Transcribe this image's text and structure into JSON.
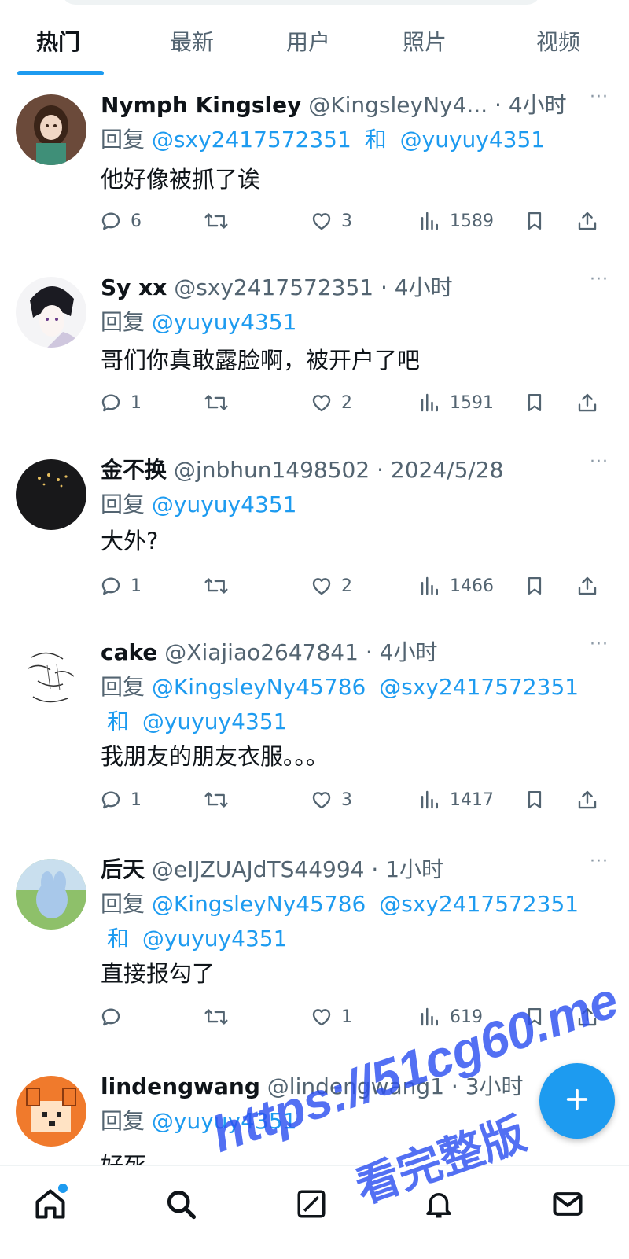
{
  "tabs": [
    {
      "label": "热门",
      "active": true
    },
    {
      "label": "最新",
      "active": false
    },
    {
      "label": "用户",
      "active": false
    },
    {
      "label": "照片",
      "active": false
    },
    {
      "label": "视频",
      "active": false
    }
  ],
  "posts": [
    {
      "name": "Nymph Kingsley",
      "handle": "@KingsleyNy4...",
      "time": "4小时",
      "reply_prefix": "回复",
      "mentions": [
        "@sxy2417572351",
        "和",
        "@yuyuy4351"
      ],
      "text": "他好像被抓了诶",
      "replies": "6",
      "reposts": "",
      "likes": "3",
      "views": "1589"
    },
    {
      "name": "Sy xx",
      "handle": "@sxy2417572351",
      "time": "4小时",
      "reply_prefix": "回复",
      "mentions": [
        "@yuyuy4351"
      ],
      "text": "哥们你真敢露脸啊，被开户了吧",
      "replies": "1",
      "reposts": "",
      "likes": "2",
      "views": "1591"
    },
    {
      "name": "金不换",
      "handle": "@jnbhun1498502",
      "time": "2024/5/28",
      "reply_prefix": "回复",
      "mentions": [
        "@yuyuy4351"
      ],
      "text": "大外?",
      "replies": "1",
      "reposts": "",
      "likes": "2",
      "views": "1466"
    },
    {
      "name": "cake",
      "handle": "@Xiajiao2647841",
      "time": "4小时",
      "reply_prefix": "回复",
      "mentions": [
        "@KingsleyNy45786",
        "@sxy2417572351",
        "和",
        "@yuyuy4351"
      ],
      "text": "我朋友的朋友衣服。。。",
      "replies": "1",
      "reposts": "",
      "likes": "3",
      "views": "1417"
    },
    {
      "name": "后天",
      "handle": "@eIJZUAJdTS44994",
      "time": "1小时",
      "reply_prefix": "回复",
      "mentions": [
        "@KingsleyNy45786",
        "@sxy2417572351",
        "和",
        "@yuyuy4351"
      ],
      "text": "直接报勾了",
      "replies": "",
      "reposts": "",
      "likes": "1",
      "views": "619"
    },
    {
      "name": "lindengwang",
      "handle": "@lindengwang1",
      "time": "3小时",
      "reply_prefix": "回复",
      "mentions": [
        "@yuyuy4351"
      ],
      "text": "好死",
      "replies": "",
      "reposts": "",
      "likes": "",
      "views": ""
    }
  ],
  "separator_dot": "·",
  "more_glyph": "···",
  "fab_icon": "plus-icon",
  "bottom_nav": [
    "home-icon",
    "search-icon",
    "grok-icon",
    "notifications-icon",
    "messages-icon"
  ],
  "watermark": {
    "line1": "https://51cg60.me",
    "line2": "看完整版"
  },
  "colors": {
    "accent": "#1d9bf0",
    "text": "#0f1419",
    "secondary": "#536471",
    "watermark": "#2d50f0"
  }
}
